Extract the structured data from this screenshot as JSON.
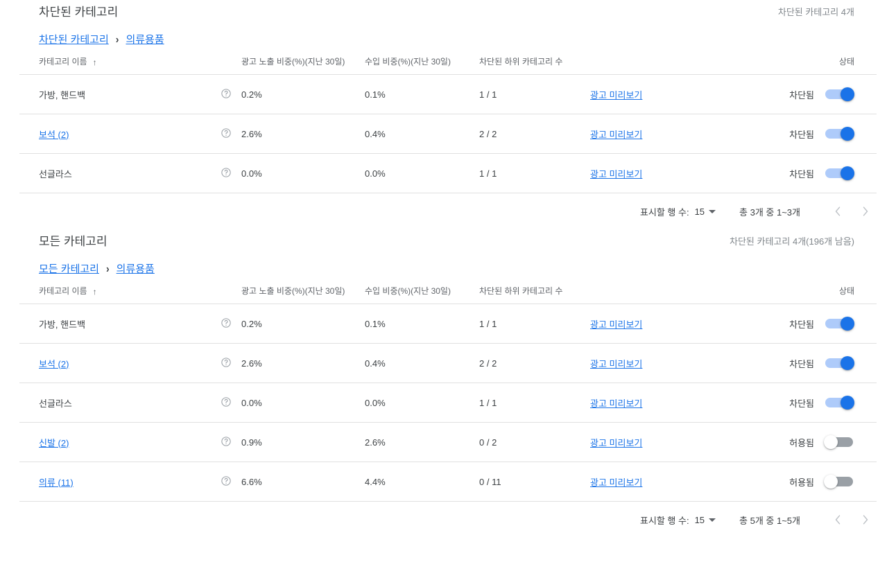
{
  "sections": [
    {
      "id": "blocked",
      "title": "차단된 카테고리",
      "count_text": "차단된 카테고리 4개",
      "breadcrumb": {
        "root": "차단된 카테고리",
        "separator": "›",
        "current": "의류용품"
      },
      "columns": {
        "name": "카테고리 이름",
        "sort_arrow": "↑",
        "impression_share": "광고 노출 비중(%)(지난 30일)",
        "revenue_share": "수입 비중(%)(지난 30일)",
        "blocked_subcats": "차단된 하위 카테고리 수",
        "status": "상태"
      },
      "rows": [
        {
          "name": "가방, 핸드백",
          "is_link": false,
          "help": "?",
          "impression_share": "0.2%",
          "revenue_share": "0.1%",
          "blocked_subcats": "1 / 1",
          "preview": "광고 미리보기",
          "status_label": "차단됨",
          "toggle": "on"
        },
        {
          "name": "보석 (2)",
          "is_link": true,
          "help": "?",
          "impression_share": "2.6%",
          "revenue_share": "0.4%",
          "blocked_subcats": "2 / 2",
          "preview": "광고 미리보기",
          "status_label": "차단됨",
          "toggle": "on"
        },
        {
          "name": "선글라스",
          "is_link": false,
          "help": "?",
          "impression_share": "0.0%",
          "revenue_share": "0.0%",
          "blocked_subcats": "1 / 1",
          "preview": "광고 미리보기",
          "status_label": "차단됨",
          "toggle": "on"
        }
      ],
      "footer": {
        "rows_label": "표시할 행 수:",
        "rows_value": "15",
        "range_label": "총 3개 중 1~3개",
        "prev_icon": "chevron-left",
        "next_icon": "chevron-right"
      }
    },
    {
      "id": "all",
      "title": "모든 카테고리",
      "count_text": "차단된 카테고리 4개(196개 남음)",
      "breadcrumb": {
        "root": "모든 카테고리",
        "separator": "›",
        "current": "의류용품"
      },
      "columns": {
        "name": "카테고리 이름",
        "sort_arrow": "↑",
        "impression_share": "광고 노출 비중(%)(지난 30일)",
        "revenue_share": "수입 비중(%)(지난 30일)",
        "blocked_subcats": "차단된 하위 카테고리 수",
        "status": "상태"
      },
      "rows": [
        {
          "name": "가방, 핸드백",
          "is_link": false,
          "help": "?",
          "impression_share": "0.2%",
          "revenue_share": "0.1%",
          "blocked_subcats": "1 / 1",
          "preview": "광고 미리보기",
          "status_label": "차단됨",
          "toggle": "on"
        },
        {
          "name": "보석 (2)",
          "is_link": true,
          "help": "?",
          "impression_share": "2.6%",
          "revenue_share": "0.4%",
          "blocked_subcats": "2 / 2",
          "preview": "광고 미리보기",
          "status_label": "차단됨",
          "toggle": "on"
        },
        {
          "name": "선글라스",
          "is_link": false,
          "help": "?",
          "impression_share": "0.0%",
          "revenue_share": "0.0%",
          "blocked_subcats": "1 / 1",
          "preview": "광고 미리보기",
          "status_label": "차단됨",
          "toggle": "on"
        },
        {
          "name": "신발 (2)",
          "is_link": true,
          "help": "?",
          "impression_share": "0.9%",
          "revenue_share": "2.6%",
          "blocked_subcats": "0 / 2",
          "preview": "광고 미리보기",
          "status_label": "허용됨",
          "toggle": "off"
        },
        {
          "name": "의류 (11)",
          "is_link": true,
          "help": "?",
          "impression_share": "6.6%",
          "revenue_share": "4.4%",
          "blocked_subcats": "0 / 11",
          "preview": "광고 미리보기",
          "status_label": "허용됨",
          "toggle": "off"
        }
      ],
      "footer": {
        "rows_label": "표시할 행 수:",
        "rows_value": "15",
        "range_label": "총 5개 중 1~5개",
        "prev_icon": "chevron-left",
        "next_icon": "chevron-right"
      }
    }
  ],
  "colors": {
    "link": "#1a73e8",
    "toggle_on_track": "#aecbfa",
    "toggle_on_thumb": "#1a73e8",
    "toggle_off_track": "#9aa0a6",
    "toggle_off_thumb": "#ffffff",
    "text_primary": "#3c4043",
    "text_secondary": "#5f6368",
    "text_muted": "#80868b",
    "divider": "#e0e0e0"
  }
}
